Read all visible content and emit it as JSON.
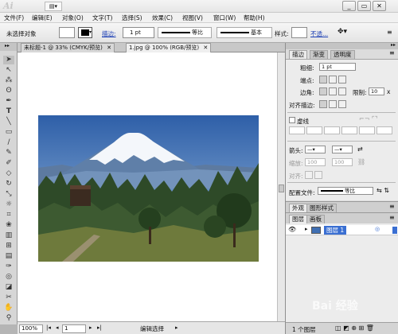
{
  "titlebar": {
    "app_logo": "Ai",
    "window_controls": [
      "_",
      "▭",
      "✕"
    ]
  },
  "menu": [
    "文件(F)",
    "编辑(E)",
    "对象(O)",
    "文字(T)",
    "选择(S)",
    "效果(C)",
    "视图(V)",
    "窗口(W)",
    "帮助(H)"
  ],
  "control_bar": {
    "selection": "未选择对象",
    "stroke_link": "描边:",
    "stroke_weight": "1 pt",
    "profile": "等比",
    "brush": "基本",
    "style_label": "样式:",
    "opacity_link": "不透..."
  },
  "document_tabs": [
    {
      "label": "未标题-1 @ 33% (CMYK/预览)",
      "close": "✕"
    },
    {
      "label": "1.jpg @ 100% (RGB/预览)",
      "close": "✕"
    }
  ],
  "status_bar": {
    "zoom": "100%",
    "page": "1",
    "tool_name": "编辑选择"
  },
  "stroke_panel": {
    "tabs": [
      "描边",
      "渐变",
      "透明度"
    ],
    "weight_label": "粗细:",
    "weight_value": "1 pt",
    "cap_label": "端点:",
    "corner_label": "边角:",
    "limit_label": "限制:",
    "limit_value": "10",
    "limit_unit": "x",
    "align_label": "对齐描边:",
    "dashed_label": "虚线",
    "arrow_label": "箭头:",
    "scale_label": "缩放:",
    "scale_1": "100",
    "scale_2": "100",
    "align_arrow_label": "对齐:",
    "profile_label": "配置文件:",
    "profile_value": "等比"
  },
  "appearance_tabs": [
    "外观",
    "图形样式"
  ],
  "layers_panel": {
    "tabs": [
      "图层",
      "画板"
    ],
    "layer_name": "图层 1",
    "footer_count": "1 个图层"
  },
  "watermark": "Bai 经验",
  "colors": {
    "accent_blue": "#1c3fb5",
    "layer_selected": "#3a6fd2",
    "sky": "#3f6fb3"
  },
  "icons": {
    "tools": [
      "selection-arrow",
      "direct-selection",
      "magic-wand",
      "lasso",
      "pen",
      "type",
      "line",
      "rectangle",
      "paintbrush",
      "pencil",
      "blob-brush",
      "eraser",
      "rotate",
      "scale",
      "warp",
      "free-transform",
      "symbol-sprayer",
      "column-graph",
      "mesh",
      "gradient",
      "eyedropper",
      "blend",
      "slice",
      "scissors",
      "hand",
      "zoom"
    ]
  }
}
